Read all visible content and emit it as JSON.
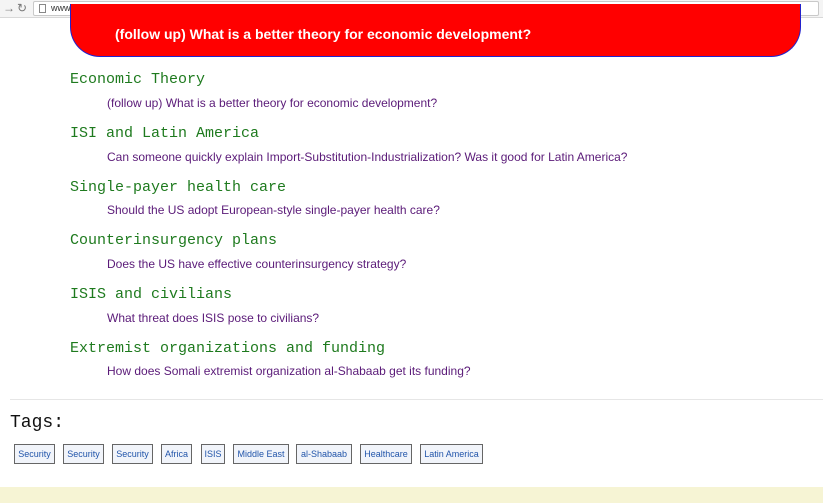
{
  "browser": {
    "url": "www.policonnect.org"
  },
  "banner": {
    "text": "(follow up) What is a better theory for economic development?"
  },
  "topics": [
    {
      "title": "Economic Theory",
      "question": "(follow up) What is a better theory for economic development?"
    },
    {
      "title": "ISI and Latin America",
      "question": "Can someone quickly explain Import-Substitution-Industrialization? Was it good for Latin America?"
    },
    {
      "title": "Single-payer health care",
      "question": "Should the US adopt European-style single-payer health care?"
    },
    {
      "title": "Counterinsurgency plans",
      "question": "Does the US have effective counterinsurgency strategy?"
    },
    {
      "title": "ISIS and civilians",
      "question": "What threat does ISIS pose to civilians?"
    },
    {
      "title": "Extremist organizations and funding",
      "question": "How does Somali extremist organization al-Shabaab get its funding?"
    }
  ],
  "tags_section": {
    "label": "Tags:",
    "tags": [
      "Security",
      "Security",
      "Security",
      "Africa",
      "ISIS",
      "Middle East",
      "al-Shabaab",
      "Healthcare",
      "Latin America"
    ]
  },
  "colors": {
    "banner_bg": "#ff0000",
    "topic_title": "#1e7a1e",
    "question_link": "#5a1a78",
    "tag_text": "#2255aa"
  },
  "icons": {
    "forward": "forward-arrow-icon",
    "reload": "reload-icon",
    "page": "page-icon"
  }
}
